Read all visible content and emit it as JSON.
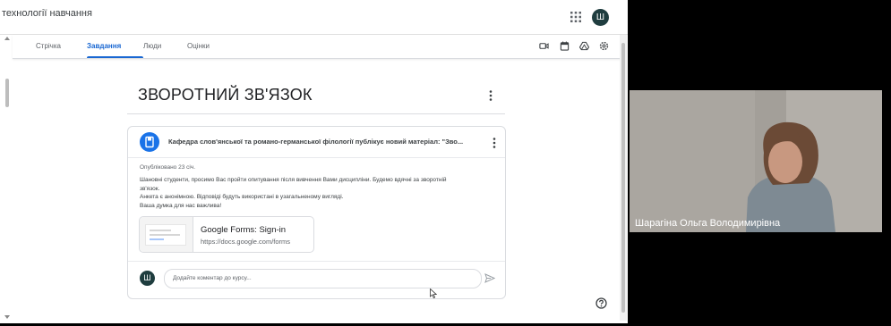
{
  "appbar": {
    "course_title": "технології навчання",
    "avatar_initial": "Ш"
  },
  "tabs": [
    {
      "label": "Стрічка",
      "active": false
    },
    {
      "label": "Завдання",
      "active": true
    },
    {
      "label": "Люди",
      "active": false
    },
    {
      "label": "Оцінки",
      "active": false
    }
  ],
  "toolbar_icons": [
    "meet-icon",
    "calendar-icon",
    "drive-icon",
    "settings-icon"
  ],
  "topic": {
    "title": "ЗВОРОТНИЙ ЗВ'ЯЗОК"
  },
  "material": {
    "heading": "Кафедра слов'янської та романо-германської філології публікує новий матеріал: \"Зво...",
    "published": "Опубліковано 23 січ.",
    "body_lines": [
      "Шановні студенти, просимо Вас пройти опитування після вивчення Вами дисципліни. Будемо вдячні за зворотній",
      "зв'язок.",
      "Анкета є анонімною. Відповіді будуть використані в узагальненому вигляді.",
      "Ваша думка для нас важлива!"
    ],
    "attachment": {
      "title": "Google Forms: Sign-in",
      "url": "https://docs.google.com/forms"
    }
  },
  "comment": {
    "avatar_initial": "Ш",
    "placeholder": "Додайте коментар до курсу..."
  },
  "video": {
    "participant_name": "Шарагіна Ольга Володимирівна"
  },
  "colors": {
    "accent": "#1967d2",
    "avatar_bg": "#1f3d3f",
    "material_icon_bg": "#1a73e8"
  }
}
